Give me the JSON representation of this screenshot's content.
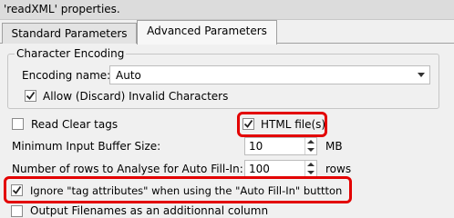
{
  "window": {
    "title": "'readXML' properties."
  },
  "tabs": [
    {
      "label": "Standard Parameters",
      "active": false
    },
    {
      "label": "Advanced Parameters",
      "active": true
    }
  ],
  "encoding_group": {
    "title": "Character Encoding",
    "encoding_label": "Encoding name:",
    "encoding_value": "Auto",
    "allow_invalid_label": "Allow (Discard) Invalid Characters",
    "allow_invalid_checked": true
  },
  "options": {
    "read_clear_tags_label": "Read Clear tags",
    "read_clear_tags_checked": false,
    "html_files_label": "HTML file(s)",
    "html_files_checked": true,
    "min_buffer_label": "Minimum Input Buffer Size:",
    "min_buffer_value": "10",
    "min_buffer_unit": "MB",
    "rows_label": "Number of rows to Analyse for Auto Fill-In:",
    "rows_value": "100",
    "rows_unit": "rows",
    "ignore_attr_label": "Ignore \"tag attributes\" when using the \"Auto Fill-In\" buttton",
    "ignore_attr_checked": true,
    "output_filenames_label": "Output Filenames as an additionnal column",
    "output_filenames_checked": false
  },
  "colors": {
    "highlight": "#e30000"
  }
}
